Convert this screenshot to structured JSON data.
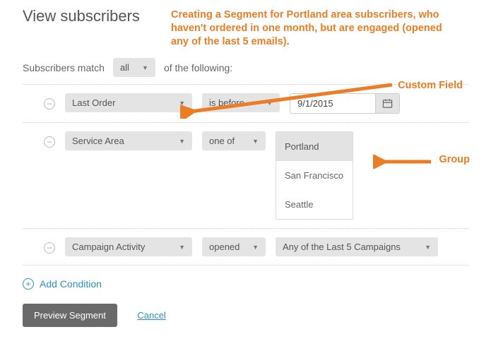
{
  "header": {
    "title": "View subscribers"
  },
  "annotation": {
    "text": "Creating a Segment for Portland area subscribers, who haven't ordered in one month, but are engaged (opened any of the last 5 emails).",
    "label_custom_field": "Custom Field",
    "label_group": "Group"
  },
  "match": {
    "prefix": "Subscribers match",
    "mode": "all",
    "suffix": "of the following:"
  },
  "conditions": [
    {
      "field": "Last Order",
      "operator": "is before",
      "date_value": "9/1/2015"
    },
    {
      "field": "Service Area",
      "operator": "one of",
      "options": [
        "Portland",
        "San Francisco",
        "Seattle"
      ],
      "selected": "Portland"
    },
    {
      "field": "Campaign Activity",
      "operator": "opened",
      "value": "Any of the Last 5 Campaigns"
    }
  ],
  "actions": {
    "add": "Add Condition",
    "preview": "Preview Segment",
    "cancel": "Cancel"
  }
}
